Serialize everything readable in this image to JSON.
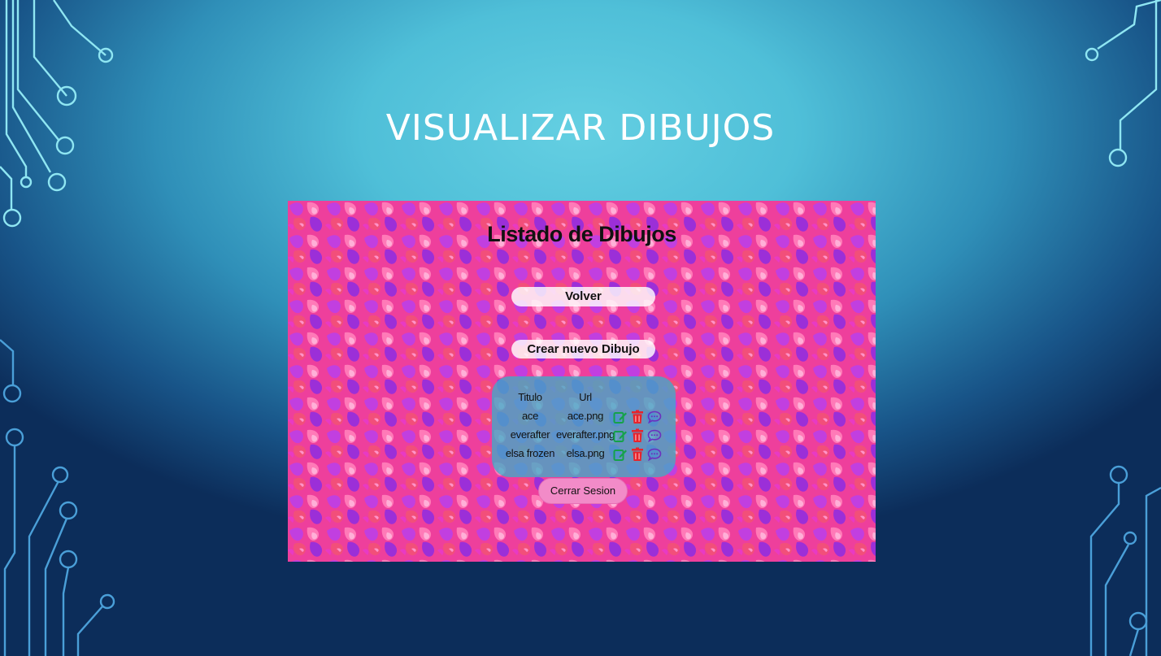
{
  "slide": {
    "title": "VISUALIZAR DIBUJOS"
  },
  "page": {
    "heading": "Listado de Dibujos",
    "back_button": "Volver",
    "create_button": "Crear nuevo Dibujo",
    "logout_button": "Cerrar Sesion"
  },
  "table": {
    "headers": {
      "titulo": "Titulo",
      "url": "Url"
    },
    "rows": [
      {
        "titulo": "ace",
        "url": "ace.png"
      },
      {
        "titulo": "everafter",
        "url": "everafter.png"
      },
      {
        "titulo": "elsa frozen",
        "url": "elsa.png"
      }
    ],
    "row_actions": [
      "edit-icon",
      "trash-icon",
      "comment-icon"
    ]
  },
  "colors": {
    "edit": "#15a24a",
    "delete": "#e8232b",
    "comment": "#6b2fbf",
    "logout_bg": "#f28bc8"
  }
}
